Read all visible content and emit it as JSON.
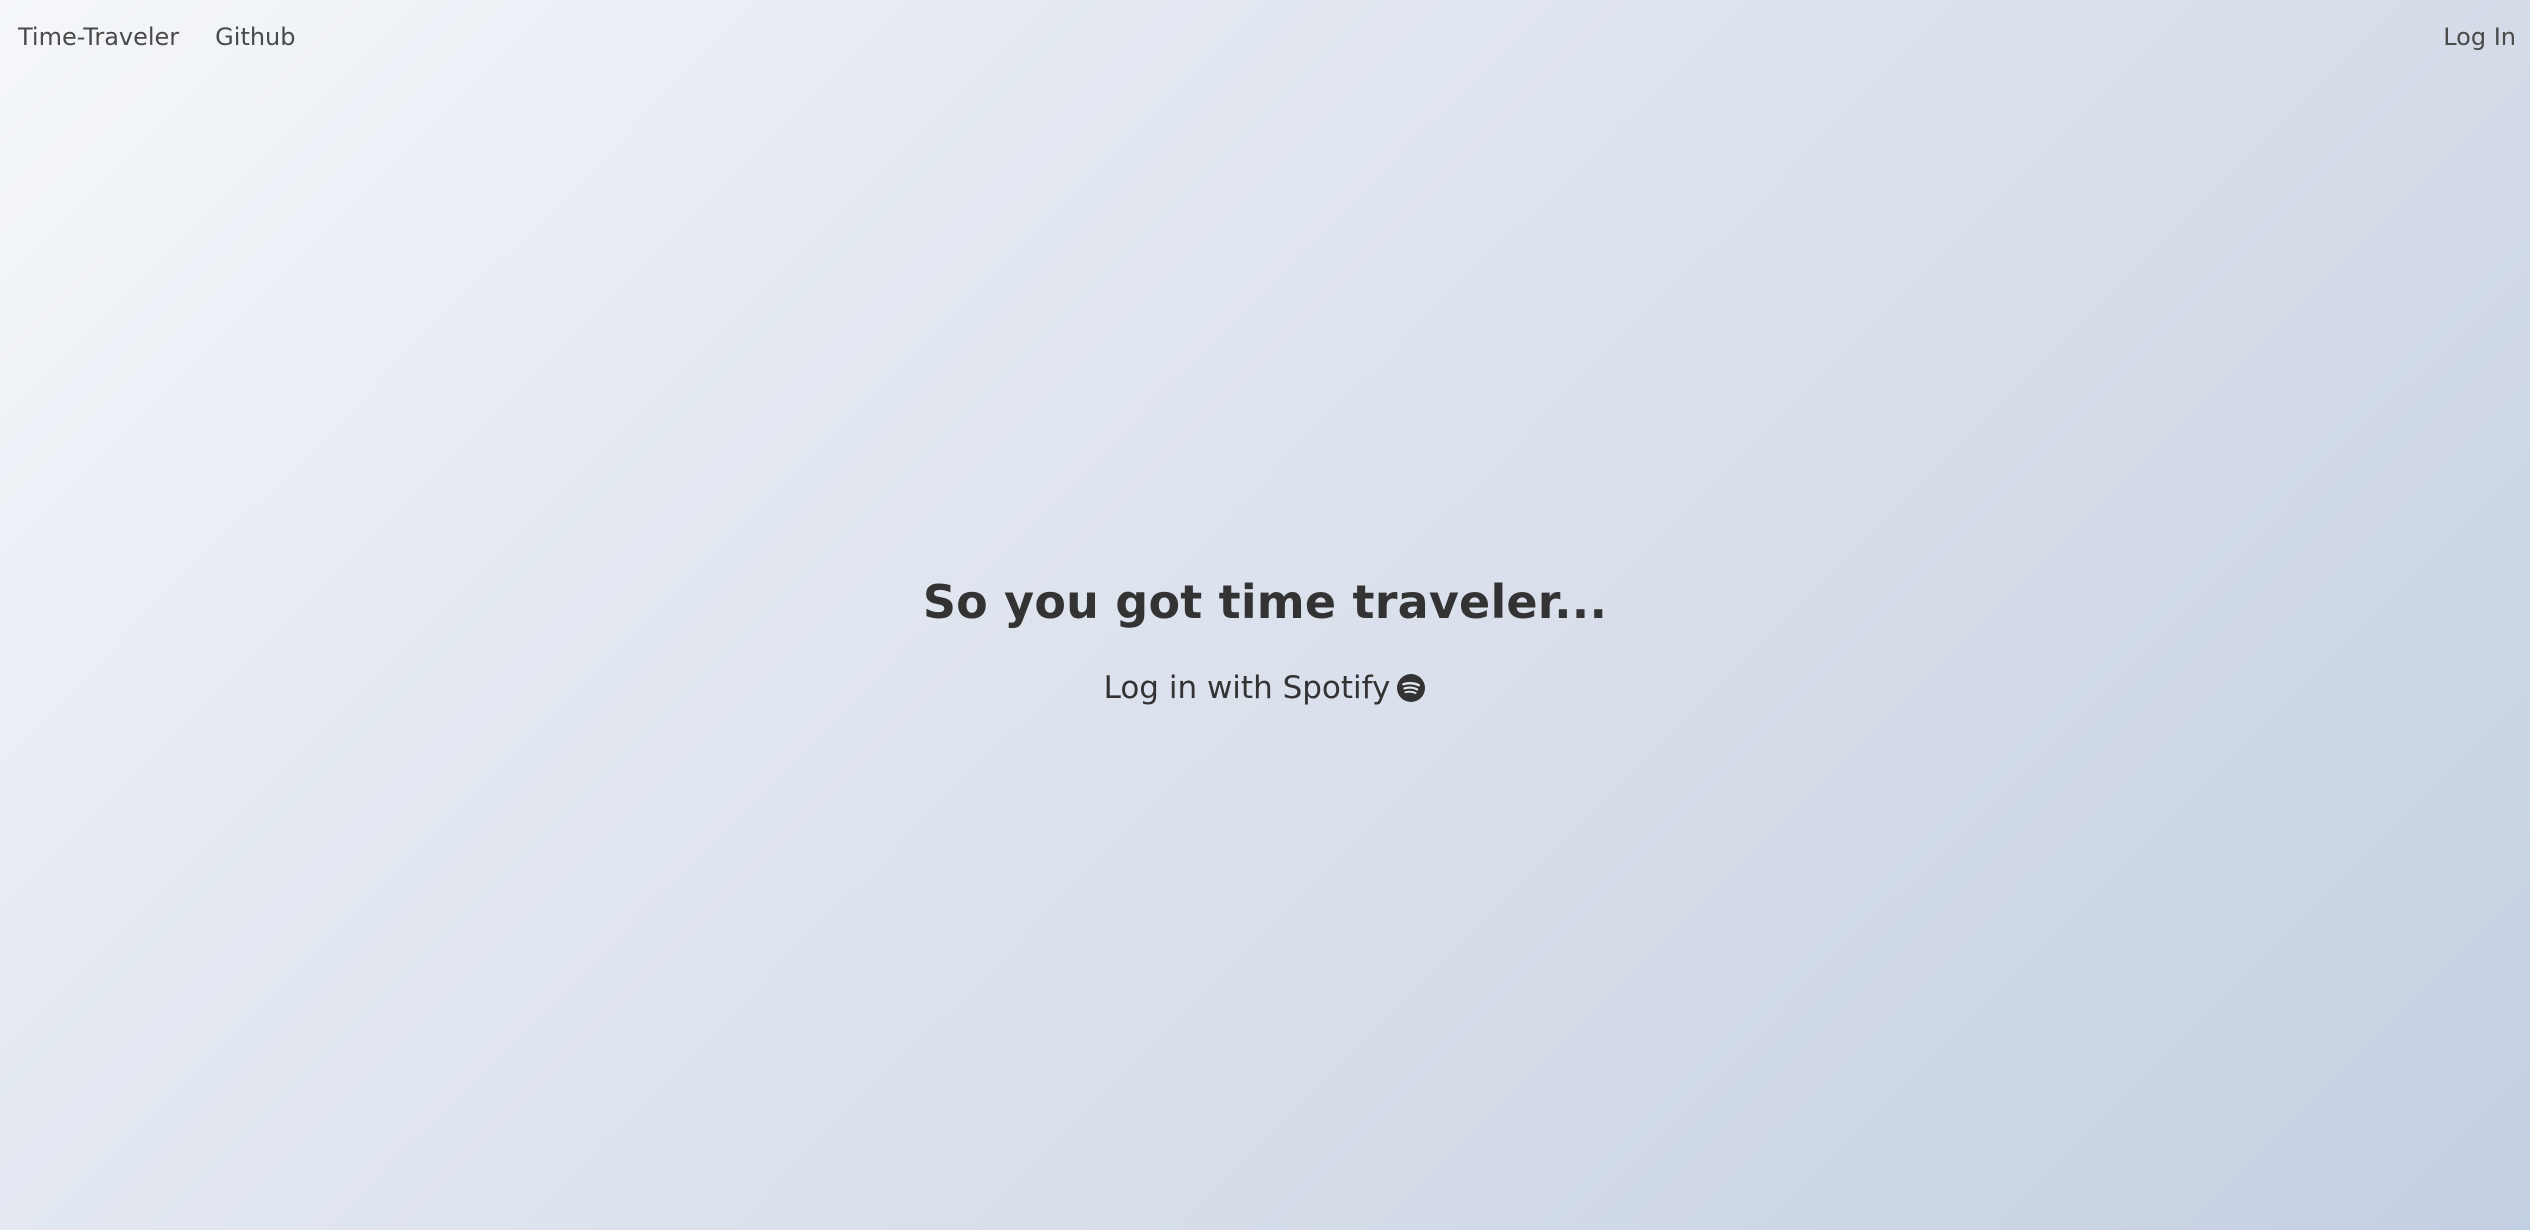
{
  "nav": {
    "brand": "Time-Traveler",
    "github": "Github",
    "login": "Log In"
  },
  "hero": {
    "title": "So you got time traveler...",
    "login_link": "Log in with Spotify",
    "icon": "spotify-icon"
  },
  "colors": {
    "text": "#333333",
    "nav_text": "#4a4a4a",
    "background_start": "#f5f7fa",
    "background_end": "#c3cfe2"
  }
}
